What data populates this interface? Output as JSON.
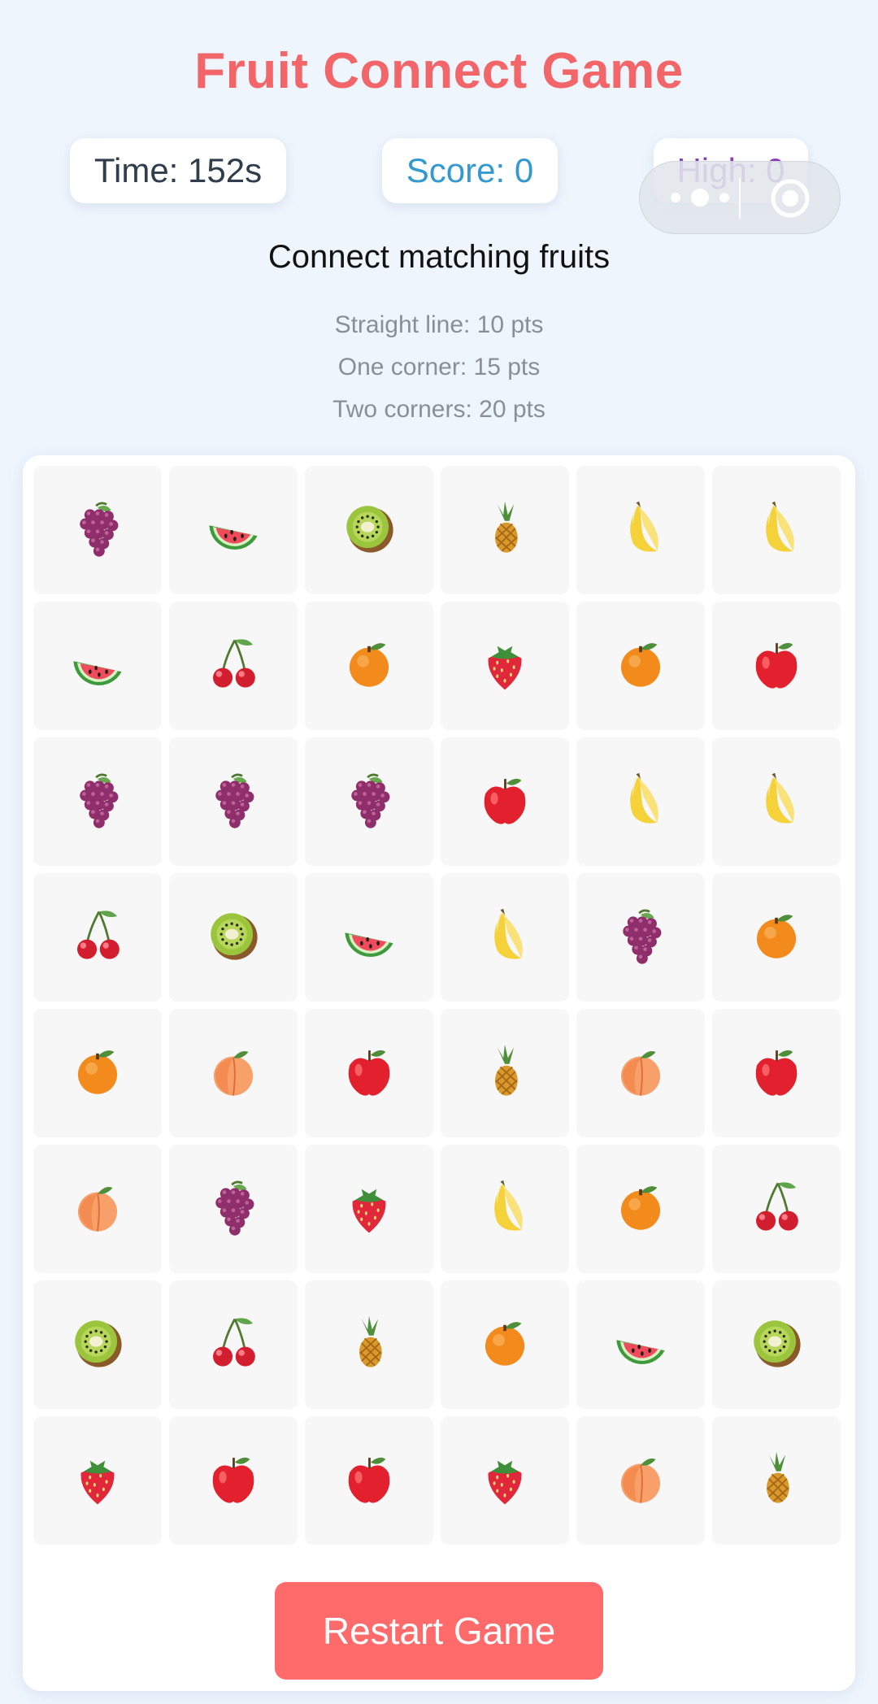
{
  "title": "Fruit Connect Game",
  "stats": {
    "time": "Time: 152s",
    "score": "Score: 0",
    "high": "High: 0"
  },
  "instruction": "Connect matching fruits",
  "rules": [
    "Straight line: 10 pts",
    "One corner: 15 pts",
    "Two corners: 20 pts"
  ],
  "board": {
    "rows": 8,
    "columns": 6,
    "tiles": [
      [
        "grapes",
        "watermelon",
        "kiwi",
        "pineapple",
        "banana",
        "banana"
      ],
      [
        "watermelon",
        "cherries",
        "orange",
        "strawberry",
        "orange",
        "apple"
      ],
      [
        "grapes",
        "grapes",
        "grapes",
        "apple",
        "banana",
        "banana"
      ],
      [
        "cherries",
        "kiwi",
        "watermelon",
        "banana",
        "grapes",
        "orange"
      ],
      [
        "orange",
        "peach",
        "apple",
        "pineapple",
        "peach",
        "apple"
      ],
      [
        "peach",
        "grapes",
        "strawberry",
        "banana",
        "orange",
        "cherries"
      ],
      [
        "kiwi",
        "cherries",
        "pineapple",
        "orange",
        "watermelon",
        "kiwi"
      ],
      [
        "strawberry",
        "apple",
        "apple",
        "strawberry",
        "peach",
        "pineapple"
      ]
    ]
  },
  "restart_label": "Restart Game",
  "colors": {
    "title": "#f2666a",
    "time": "#2f3d4d",
    "score": "#3499d1",
    "high": "#8b3fb3",
    "restart_button": "#ff6b6b",
    "background": "#eef5fd",
    "tile": "#f7f7f7"
  },
  "icons": {
    "capsule_more": "more-dots-icon",
    "capsule_close": "target-close-icon"
  }
}
